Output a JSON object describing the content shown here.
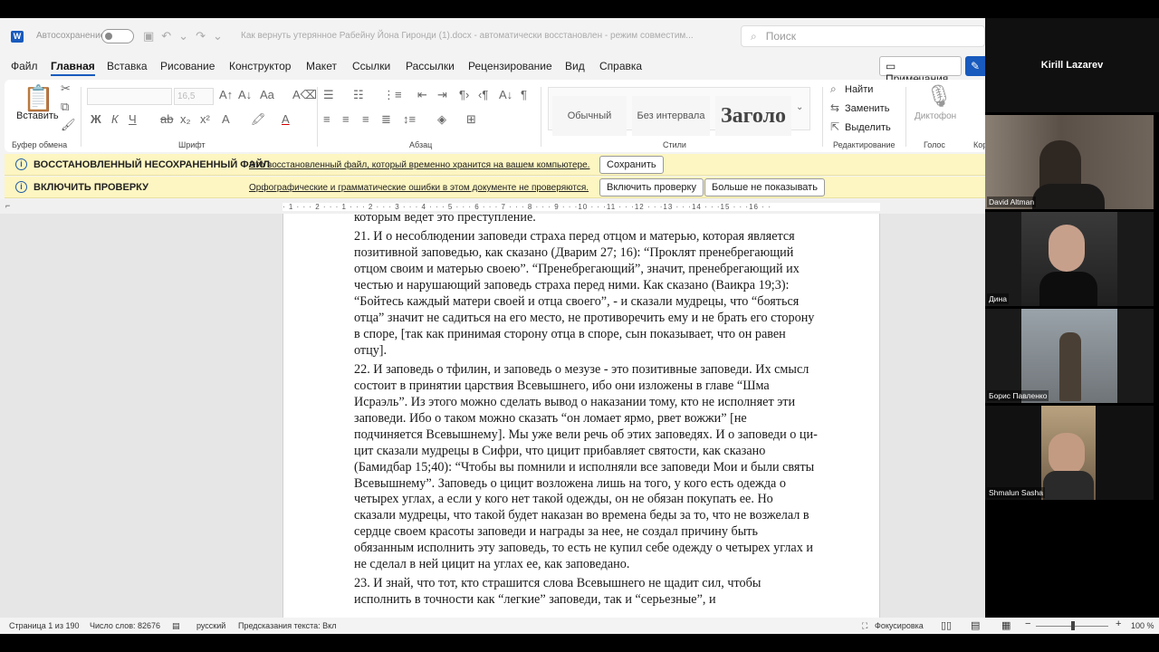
{
  "window": {
    "autosave_label": "Автосохранение",
    "doc_title": "Как вернуть утерянное Рабейну Йона Гиронди (1).docx  -  автоматически восстановлен  -  режим совместим...",
    "search_placeholder": "Поиск"
  },
  "menu": [
    "Файл",
    "Главная",
    "Вставка",
    "Рисование",
    "Конструктор",
    "Макет",
    "Ссылки",
    "Рассылки",
    "Рецензирование",
    "Вид",
    "Справка"
  ],
  "notes_button": "Примечания",
  "ribbon": {
    "clipboard": {
      "paste": "Вставить",
      "label": "Буфер обмена"
    },
    "font": {
      "size": "16,5",
      "label": "Шрифт"
    },
    "paragraph": {
      "label": "Абзац"
    },
    "styles": {
      "label": "Стили",
      "items": [
        "Обычный",
        "Без интервала",
        "Заголо"
      ]
    },
    "editing": {
      "label": "Редактирование",
      "find": "Найти",
      "replace": "Заменить",
      "select": "Выделить"
    },
    "voice": {
      "label": "Голос",
      "dictate": "Диктофон"
    },
    "extra": {
      "label": "Кор"
    }
  },
  "bars": [
    {
      "title": "ВОССТАНОВЛЕННЫЙ НЕСОХРАНЕННЫЙ ФАЙЛ",
      "text": "Это восстановленный файл, который временно хранится на вашем компьютере.",
      "buttons": [
        "Сохранить"
      ]
    },
    {
      "title": "ВКЛЮЧИТЬ ПРОВЕРКУ",
      "text": "Орфографические и грамматические ошибки в этом документе не проверяются.",
      "buttons": [
        "Включить проверку",
        "Больше не показывать"
      ]
    }
  ],
  "ruler_text": "· 1 · · · 2 · · · 1 · · · 2 · · · 3 · · · 4 · · · 5 · · · 6 · · · 7 · · · 8 · · · 9 · · ·10 · · ·11 · · ·12 · · ·13 · · ·14 · · ·15 · · ·16 · ·",
  "document": {
    "paragraphs": [
      "которым ведет это преступление.",
      "21.    И о несоблюдении заповеди страха перед отцом и матерью, которая является позитивной заповедью, как сказано (Дварим 27; 16): “Проклят пренебрегающий отцом своим и матерью своею”. “Пренебрегающий”, значит, пренебрегающий их честью и нарушающий заповедь страха перед ними. Как сказано (Ваикра 19;3): “Бойтесь каждый матери своей и отца своего”, - и сказали мудрецы, что “бояться отца” значит не садиться на его место, не противоречить ему и не брать его сторону в споре, [так как принимая сторону отца в споре, сын показывает, что он равен отцу].",
      "22.    И заповедь о тфилин, и заповедь о мезузе - это позитивные заповеди. Их смысл состоит в принятии царствия Всевышнего, ибо они изложены в главе “Шма Исраэль”. Из этого можно сделать вывод о наказании тому, кто не исполняет эти заповеди. Ибо о таком можно сказать “он ломает ярмо, рвет вожжи” [не подчиняется Всевышнему]. Мы уже вели речь об этих заповедях. И о заповеди о ци-цит сказали мудрецы в Сифри, что цицит прибавляет святости, как сказано (Бамидбар 15;40): “Чтобы вы помнили и исполняли все заповеди Мои и были святы Всевышнему”. Заповедь о цицит возложена лишь на того, у кого есть одежда о четырех углах, а если у кого нет такой одежды, он не обязан покупать ее. Но сказали мудрецы, что такой будет наказан во времена беды за то, что не возжелал в сердце своем красоты заповеди и награды за нее, не создал причину быть обязанным исполнить эту заповедь, то есть не купил себе одежду о четырех углах и не сделал в ней цицит на углах ее, как заповедано.",
      "23.    И знай, что тот, кто страшится слова Всевышнего не щадит сил, чтобы исполнить в точности как “легкие” заповеди, так и “серьезные”, и"
    ]
  },
  "status": {
    "page": "Страница 1 из 190",
    "words": "Число слов: 82676",
    "lang": "русский",
    "predict": "Предсказания текста: Вкл",
    "focus": "Фокусировка",
    "zoom": "100 %"
  },
  "zoom": {
    "host": "Kirill Lazarev",
    "participants": [
      "David Altman",
      "Дина",
      "Борис Павленко",
      "Shmalun Sasha"
    ]
  }
}
